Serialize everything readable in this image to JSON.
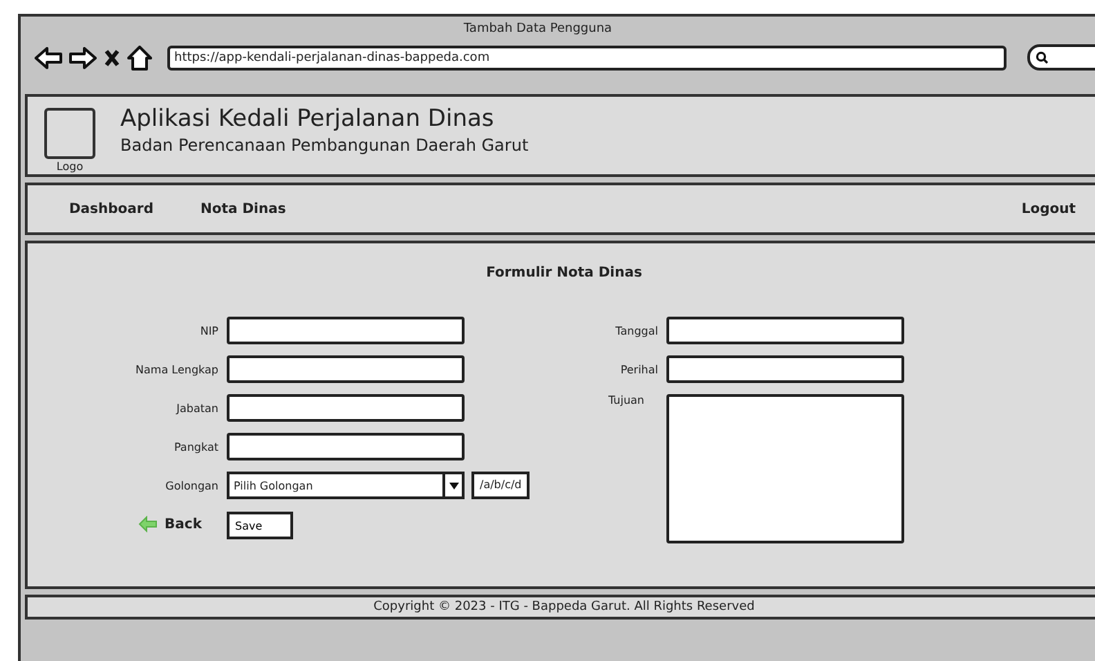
{
  "window": {
    "title": "Tambah Data Pengguna",
    "url": "https://app-kendali-perjalanan-dinas-bappeda.com"
  },
  "header": {
    "logo_label": "Logo",
    "title": "Aplikasi Kedali Perjalanan Dinas",
    "subtitle": "Badan Perencanaan Pembangunan Daerah Garut"
  },
  "nav": {
    "items": [
      {
        "label": "Dashboard"
      },
      {
        "label": "Nota Dinas"
      }
    ],
    "logout": "Logout"
  },
  "form": {
    "title": "Formulir Nota Dinas",
    "left_fields": [
      {
        "label": "NIP",
        "kind": "text"
      },
      {
        "label": "Nama Lengkap",
        "kind": "text"
      },
      {
        "label": "Jabatan",
        "kind": "text"
      },
      {
        "label": "Pangkat",
        "kind": "text"
      },
      {
        "label": "Golongan",
        "kind": "select",
        "value": "Pilih Golongan",
        "extra_value": "/a/b/c/d"
      }
    ],
    "right_fields": [
      {
        "label": "Tanggal",
        "kind": "text"
      },
      {
        "label": "Perihal",
        "kind": "text"
      },
      {
        "label": "Tujuan",
        "kind": "textarea"
      }
    ],
    "back": "Back",
    "save": "Save"
  },
  "footer": "Copyright ©  2023 - ITG - Bappeda Garut.  All Rights Reserved"
}
